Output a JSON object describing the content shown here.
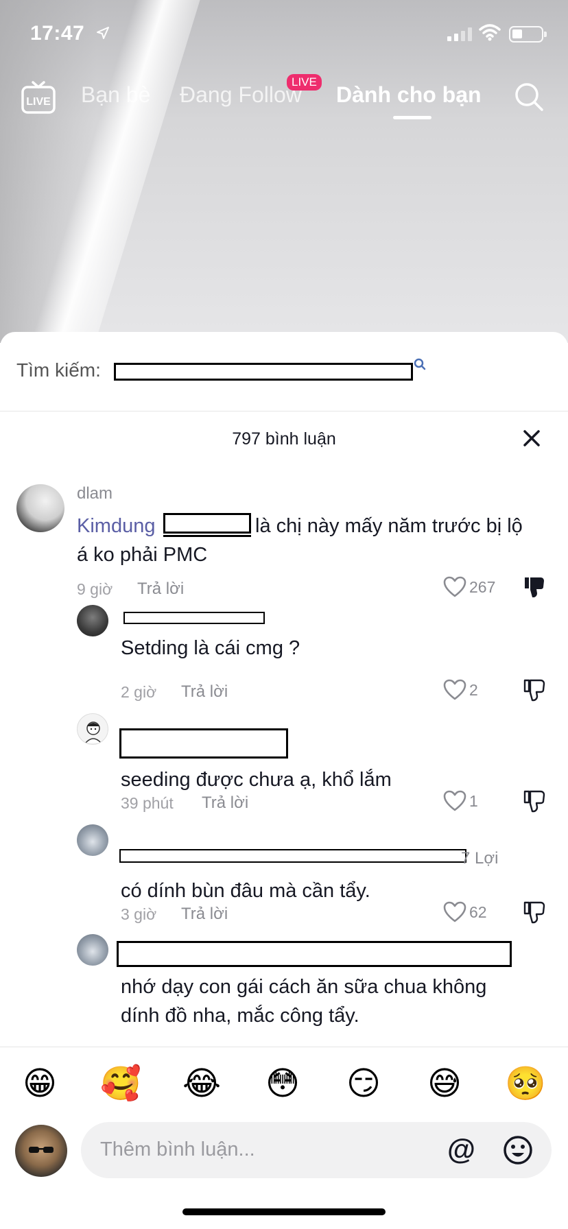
{
  "status_bar": {
    "time": "17:47"
  },
  "top_nav": {
    "live_icon_label": "LIVE",
    "tabs": [
      "Bạn bè",
      "Đang Follow",
      "Dành cho bạn"
    ],
    "live_badge": "LIVE"
  },
  "search": {
    "label": "Tìm kiếm:"
  },
  "comments_header": {
    "count_text": "797 bình luận"
  },
  "comments": [
    {
      "username": "dlam",
      "mention": "Kimdung",
      "text_line1": " là chị này mấy năm trước bị lộ",
      "text_line2": "á ko phải PMC",
      "time": "9 giờ",
      "reply": "Trả lời",
      "likes": "267"
    },
    {
      "text": "Setding là cái cmg ?",
      "time": "2 giờ",
      "reply": "Trả lời",
      "likes": "2"
    },
    {
      "text": "seeding được chưa ạ, khổ lắm",
      "time": "39 phút",
      "reply": "Trả lời",
      "likes": "1"
    },
    {
      "username_suffix": "7 Lợi",
      "text": "có dính bùn đâu mà cần tẩy.",
      "time": "3 giờ",
      "reply": "Trả lời",
      "likes": "62"
    },
    {
      "text_line1": "nhớ dạy con gái cách ăn sữa chua không",
      "text_line2": "dính đồ nha, mắc công tẩy."
    }
  ],
  "emojis": [
    "😁",
    "🥰",
    "😂",
    "😳",
    "😏",
    "😅",
    "🥺"
  ],
  "composer": {
    "placeholder": "Thêm bình luận...",
    "at_symbol": "@"
  },
  "colors": {
    "accent": "#ee2d6d",
    "mention": "#5a5ea5"
  }
}
